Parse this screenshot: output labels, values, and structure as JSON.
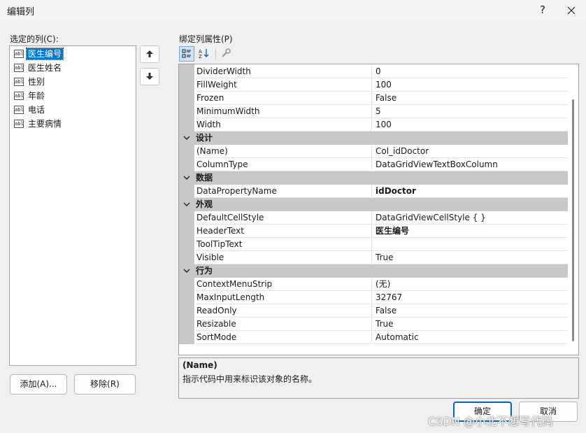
{
  "window": {
    "title": "编辑列",
    "help_label": "?"
  },
  "left": {
    "label": "选定的列(C):",
    "icon_text": "abl",
    "columns": [
      {
        "label": "医生编号",
        "selected": true
      },
      {
        "label": "医生姓名"
      },
      {
        "label": "性别"
      },
      {
        "label": "年龄"
      },
      {
        "label": "电话"
      },
      {
        "label": "主要病情"
      }
    ],
    "add_label": "添加(A)...",
    "remove_label": "移除(R)"
  },
  "right": {
    "label": "绑定列属性(P)",
    "toolbar": {
      "categorized_icon": "categorized-icon",
      "alphabetical_icon": "alphabetical-icon",
      "property_pages_icon": "wrench-icon"
    }
  },
  "properties": {
    "rows": [
      {
        "type": "prop",
        "name": "DividerWidth",
        "value": "0"
      },
      {
        "type": "prop",
        "name": "FillWeight",
        "value": "100"
      },
      {
        "type": "prop",
        "name": "Frozen",
        "value": "False"
      },
      {
        "type": "prop",
        "name": "MinimumWidth",
        "value": "5"
      },
      {
        "type": "prop",
        "name": "Width",
        "value": "100"
      },
      {
        "type": "cat",
        "name": "设计"
      },
      {
        "type": "prop",
        "name": "(Name)",
        "value": "Col_idDoctor"
      },
      {
        "type": "prop",
        "name": "ColumnType",
        "value": "DataGridViewTextBoxColumn"
      },
      {
        "type": "cat",
        "name": "数据"
      },
      {
        "type": "prop",
        "name": "DataPropertyName",
        "value": "idDoctor",
        "bold": true
      },
      {
        "type": "cat",
        "name": "外观"
      },
      {
        "type": "prop",
        "name": "DefaultCellStyle",
        "value": "DataGridViewCellStyle { }"
      },
      {
        "type": "prop",
        "name": "HeaderText",
        "value": "医生编号",
        "bold": true
      },
      {
        "type": "prop",
        "name": "ToolTipText",
        "value": ""
      },
      {
        "type": "prop",
        "name": "Visible",
        "value": "True"
      },
      {
        "type": "cat",
        "name": "行为"
      },
      {
        "type": "prop",
        "name": "ContextMenuStrip",
        "value": "(无)"
      },
      {
        "type": "prop",
        "name": "MaxInputLength",
        "value": "32767"
      },
      {
        "type": "prop",
        "name": "ReadOnly",
        "value": "False"
      },
      {
        "type": "prop",
        "name": "Resizable",
        "value": "True"
      },
      {
        "type": "prop",
        "name": "SortMode",
        "value": "Automatic"
      }
    ]
  },
  "description": {
    "title": "(Name)",
    "text": "指示代码中用来标识该对象的名称。"
  },
  "footer": {
    "ok_label": "确定",
    "cancel_label": "取消"
  },
  "watermark": "CSDN @小北不想写代码",
  "colors": {
    "selection": "#0078d7",
    "category_bg": "#c8c8c8",
    "primary_border": "#0067c0"
  }
}
